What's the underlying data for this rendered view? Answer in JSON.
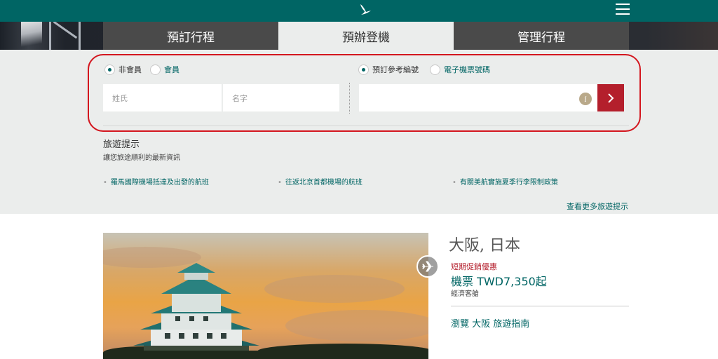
{
  "header": {
    "logo_icon": "brushwing-logo-icon",
    "menu_icon": "hamburger-menu-icon"
  },
  "tabs": [
    {
      "label": "預訂行程",
      "active": false
    },
    {
      "label": "預辦登機",
      "active": true
    },
    {
      "label": "管理行程",
      "active": false
    }
  ],
  "checkin": {
    "member_options": [
      {
        "label": "非會員",
        "selected": true
      },
      {
        "label": "會員",
        "selected": false
      }
    ],
    "ref_options": [
      {
        "label": "預訂參考編號",
        "selected": true
      },
      {
        "label": "電子機票號碼",
        "selected": false
      }
    ],
    "surname_placeholder": "姓氏",
    "givenname_placeholder": "名字",
    "reference_value": "",
    "info_icon": "info-icon",
    "go_icon": "chevron-right-icon"
  },
  "tips": {
    "title": "旅遊提示",
    "subtitle": "讓您旅途順利的最新資訊",
    "links": [
      "羅馬國際機場抵達及出發的航班",
      "往返北京首都機場的航班",
      "有關美航實施夏季行李限制政策"
    ],
    "more": "查看更多旅遊提示"
  },
  "destination": {
    "title": "大阪, 日本",
    "promo": "短期促銷優惠",
    "price": "機票 TWD7,350起",
    "cabin": "經濟客艙",
    "guide_link": "瀏覽 大阪 旅遊指南",
    "plane_icon": "airplane-icon"
  },
  "colors": {
    "brand_teal": "#006564",
    "accent_red": "#b41f2c",
    "highlight_oval": "#d3161e"
  }
}
